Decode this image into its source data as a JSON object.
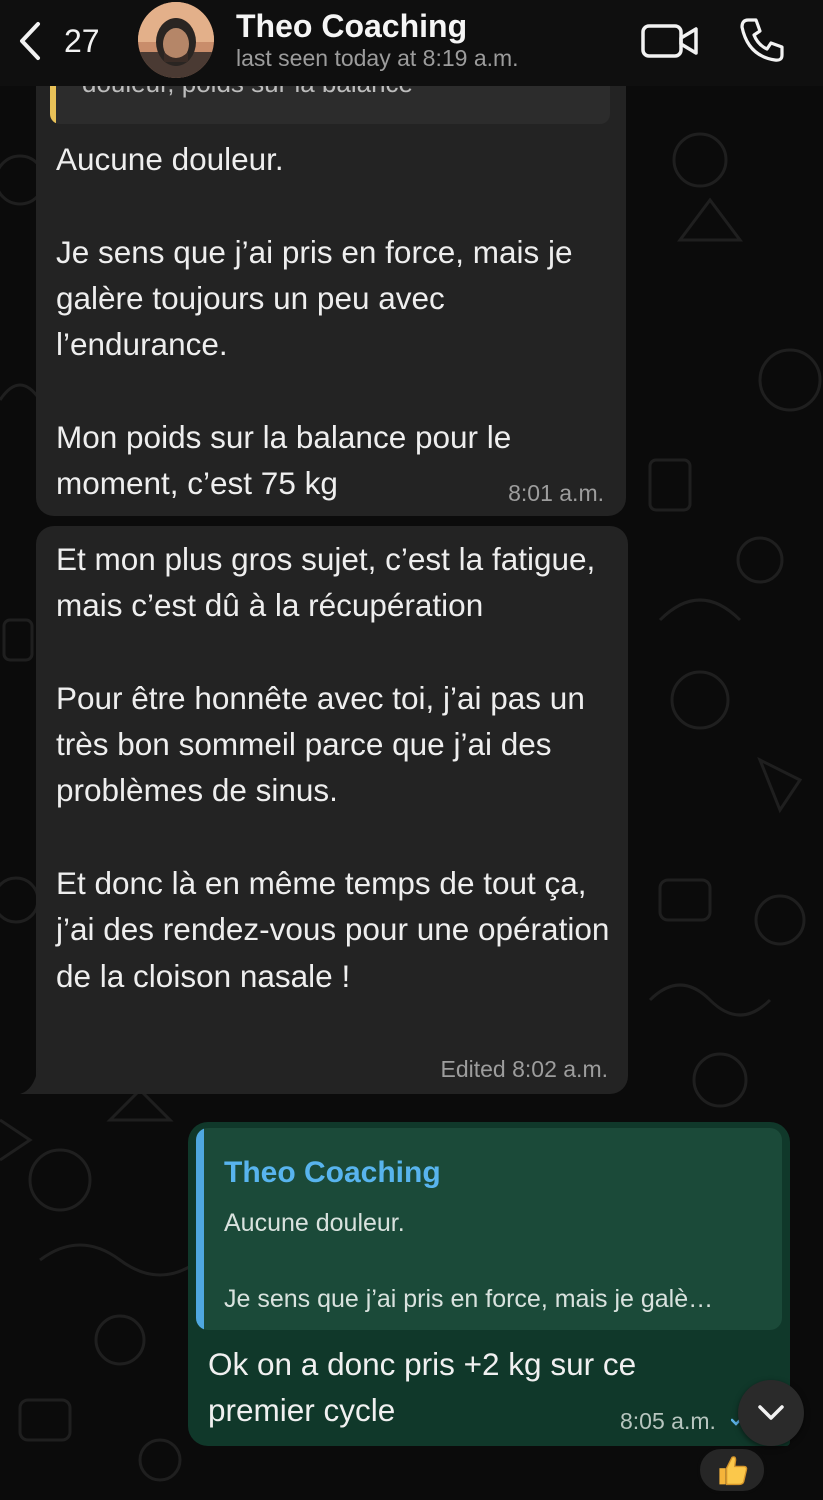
{
  "header": {
    "back_count": "27",
    "contact_name": "Theo Coaching",
    "last_seen": "last seen today at 8:19 a.m.",
    "back_icon": "chevron-left-icon",
    "video_icon": "video-camera-icon",
    "call_icon": "phone-icon"
  },
  "messages": [
    {
      "quote_fragment": "douleur, poids sur la balance",
      "text": "Aucune douleur.\n\nJe sens que j’ai pris en force, mais je galère toujours un peu avec l’endurance.\n\nMon poids sur la balance pour le moment, c’est 75 kg",
      "time": "8:01 a.m."
    },
    {
      "text": "Et mon plus gros sujet, c’est la fatigue, mais c’est dû à la récupération\n\nPour être honnête avec toi, j’ai pas un très bon sommeil parce que j’ai des problèmes de sinus.\n\nEt donc là en même temps de tout ça, j’ai des rendez-vous pour une opération de la cloison nasale !",
      "time": "Edited 8:02 a.m."
    },
    {
      "reply_to_name": "Theo Coaching",
      "reply_to_text": "Aucune douleur.\n\nJe sens que j’ai pris en force, mais je galè…",
      "text": "Ok on a donc pris +2 kg sur ce premier cycle",
      "time": "8:05 a.m.",
      "reaction": "👍"
    }
  ],
  "colors": {
    "incoming_bubble": "#232323",
    "outgoing_bubble": "#10382a",
    "reply_name": "#58b4ee",
    "quote_bar_incoming": "#e8c158",
    "quote_bar_outgoing": "#4fa8e0"
  }
}
